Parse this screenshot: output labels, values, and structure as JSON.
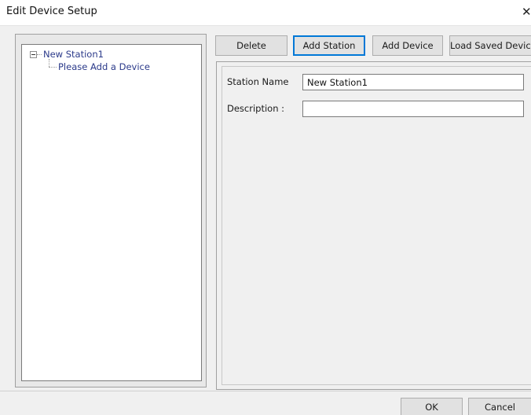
{
  "window": {
    "title": "Edit Device Setup",
    "close_glyph": "✕"
  },
  "tree": {
    "expander_icon": "minus-box",
    "station": "New Station1",
    "device_placeholder": "Please Add a Device"
  },
  "toolbar": {
    "delete_label": "Delete",
    "add_station_label": "Add Station",
    "add_device_label": "Add Device",
    "load_saved_label": "Load Saved Device"
  },
  "form": {
    "station_name_label": "Station Name",
    "station_name_value": "New Station1",
    "description_label": "Description :",
    "description_value": ""
  },
  "footer": {
    "ok_label": "OK",
    "cancel_label": "Cancel"
  },
  "colors": {
    "accent": "#0078d7",
    "tree_text": "#2b3a8a"
  }
}
